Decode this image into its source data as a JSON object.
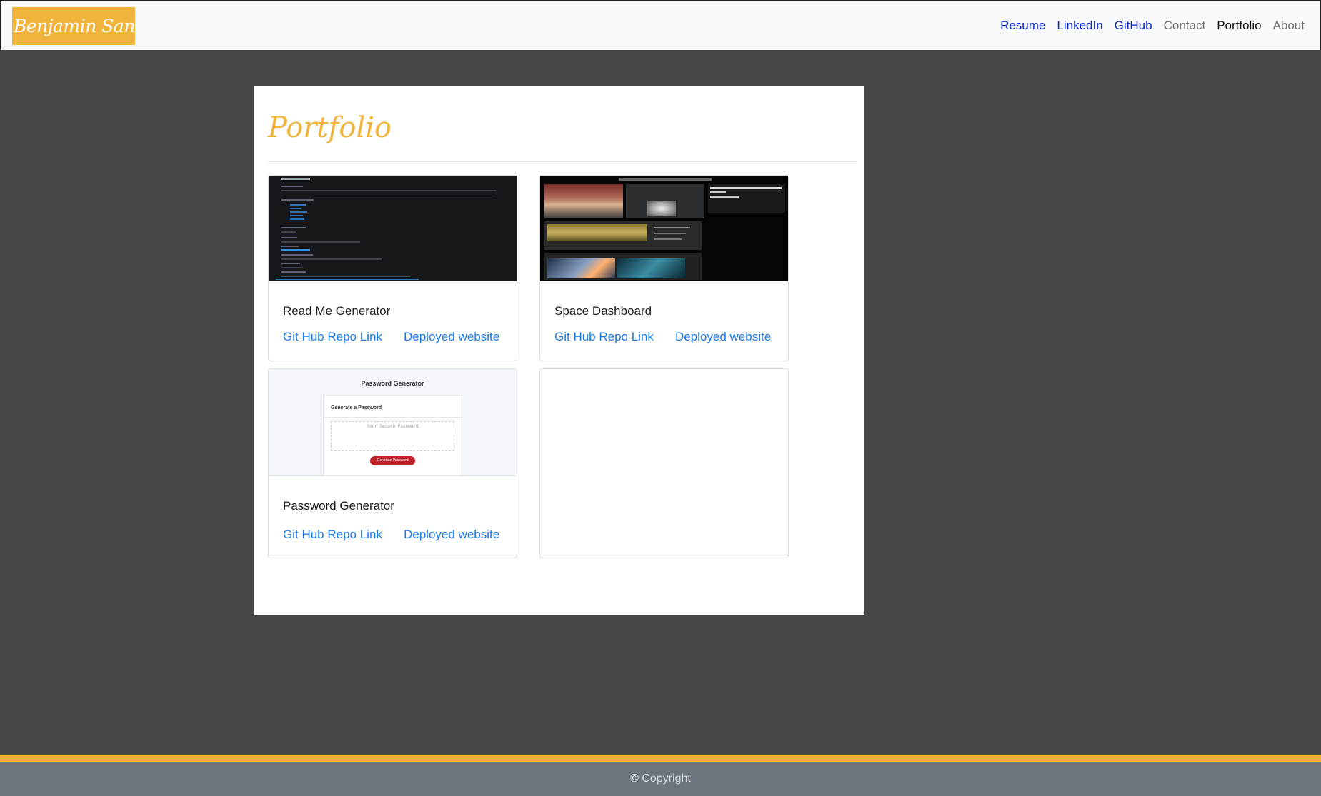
{
  "navbar": {
    "brand": "Benjamin Santos",
    "links": [
      {
        "label": "Resume"
      },
      {
        "label": "LinkedIn"
      },
      {
        "label": "GitHub"
      },
      {
        "label": "Contact"
      },
      {
        "label": "Portfolio"
      },
      {
        "label": "About"
      }
    ]
  },
  "page": {
    "title": "Portfolio"
  },
  "projects": [
    {
      "title": "Read Me Generator",
      "repo_label": "Git Hub Repo Link",
      "site_label": "Deployed website",
      "thumbnail": "readme-screenshot"
    },
    {
      "title": "Space Dashboard",
      "repo_label": "Git Hub Repo Link",
      "site_label": "Deployed website",
      "thumbnail": "space-dashboard-screenshot"
    },
    {
      "title": "Password Generator",
      "repo_label": "Git Hub Repo Link",
      "site_label": "Deployed website",
      "thumbnail": "password-generator-screenshot",
      "preview": {
        "heading": "Password Generator",
        "subheading": "Generate a Password",
        "placeholder": "Your Secure Password",
        "button": "Generate Password"
      }
    }
  ],
  "footer": {
    "text": "© Copyright"
  },
  "colors": {
    "accent": "#f0b43c",
    "background": "#474747",
    "navbar": "#f8f9fa",
    "link": "#1a7ae6",
    "footer": "#6c757d"
  }
}
